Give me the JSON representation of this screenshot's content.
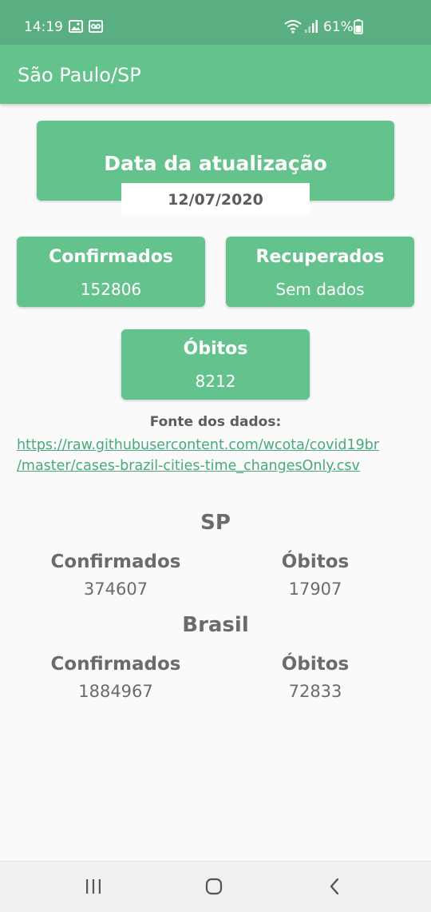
{
  "status_bar": {
    "time": "14:19",
    "battery": "61%",
    "icons": [
      "gallery-icon",
      "voicemail-icon",
      "wifi-icon",
      "signal-icon",
      "battery-icon"
    ]
  },
  "app_bar": {
    "title": "São Paulo/SP"
  },
  "update_card": {
    "title": "Data da atualização",
    "date": "12/07/2020"
  },
  "city_stats": {
    "confirmed_label": "Confirmados",
    "confirmed_value": "152806",
    "recovered_label": "Recuperados",
    "recovered_value": "Sem dados",
    "deaths_label": "Óbitos",
    "deaths_value": "8212"
  },
  "source": {
    "label": "Fonte dos dados:",
    "link_line1": "https://raw.githubusercontent.com/wcota/covid19br",
    "link_line2": "/master/cases-brazil-cities-time_changesOnly.csv"
  },
  "state_section": {
    "title": "SP",
    "confirmed_label": "Confirmados",
    "confirmed_value": "374607",
    "deaths_label": "Óbitos",
    "deaths_value": "17907"
  },
  "country_section": {
    "title": "Brasil",
    "confirmed_label": "Confirmados",
    "confirmed_value": "1884967",
    "deaths_label": "Óbitos",
    "deaths_value": "72833"
  },
  "nav_bar": {
    "icons": [
      "recent-apps-icon",
      "home-icon",
      "back-icon"
    ]
  },
  "colors": {
    "status_bar": "#5aaf82",
    "primary": "#64c38d",
    "link": "#49a97a",
    "text_gray": "#6b6b6b",
    "background": "#fafafa"
  }
}
